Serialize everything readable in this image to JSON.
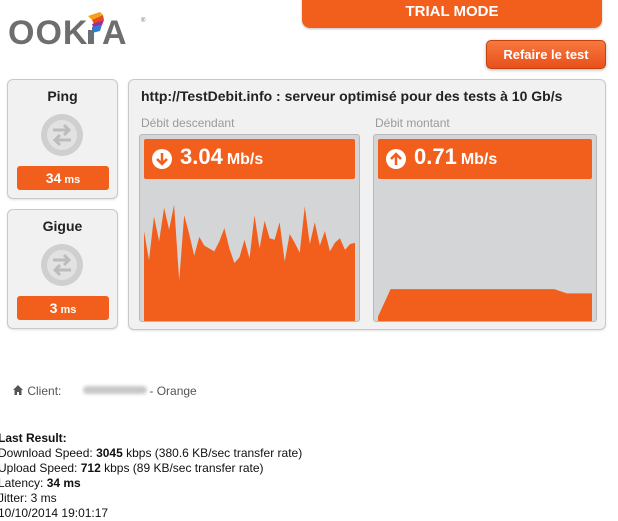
{
  "brand": {
    "logo_text": "OOKLA",
    "accent": "#f25f1c"
  },
  "header": {
    "trial_label": "TRIAL MODE",
    "retest_label": "Refaire le test"
  },
  "ping": {
    "label": "Ping",
    "value": "34",
    "unit": "ms",
    "icon": "arrows-swap-icon"
  },
  "jitter": {
    "label": "Gigue",
    "value": "3",
    "unit": "ms",
    "icon": "arrows-swap-icon"
  },
  "server": {
    "text": "http://TestDebit.info : serveur optimisé pour des tests à 10 Gb/s"
  },
  "download": {
    "label": "Débit descendant",
    "value": "3.04",
    "unit": "Mb/s",
    "icon": "down-arrow-icon",
    "levels": [
      0.62,
      0.42,
      0.72,
      0.55,
      0.78,
      0.63,
      0.8,
      0.28,
      0.73,
      0.6,
      0.45,
      0.58,
      0.52,
      0.5,
      0.48,
      0.55,
      0.64,
      0.5,
      0.4,
      0.44,
      0.56,
      0.43,
      0.73,
      0.5,
      0.69,
      0.57,
      0.56,
      0.68,
      0.41,
      0.6,
      0.54,
      0.47,
      0.79,
      0.53,
      0.68,
      0.52,
      0.62,
      0.48,
      0.54,
      0.57,
      0.49,
      0.53,
      0.54
    ]
  },
  "upload": {
    "label": "Débit montant",
    "value": "0.71",
    "unit": "Mb/s",
    "icon": "up-arrow-icon",
    "levels": [
      0.03,
      0.22,
      0.22,
      0.22,
      0.22,
      0.22,
      0.22,
      0.22,
      0.22,
      0.22,
      0.22,
      0.22,
      0.22,
      0.22,
      0.22,
      0.19,
      0.19,
      0.19
    ]
  },
  "client": {
    "label": "Client:",
    "isp": "- Orange"
  },
  "last_result": {
    "title": "Last Result:",
    "download_prefix": "Download Speed: ",
    "download_value": "3045",
    "download_suffix": " kbps (380.6 KB/sec transfer rate)",
    "upload_prefix": "Upload Speed: ",
    "upload_value": "712",
    "upload_suffix": " kbps (89 KB/sec transfer rate)",
    "latency_prefix": "Latency: ",
    "latency_value": "34 ms",
    "jitter_text": "Jitter: 3 ms",
    "date_text": "10/10/2014 19:01:17"
  }
}
